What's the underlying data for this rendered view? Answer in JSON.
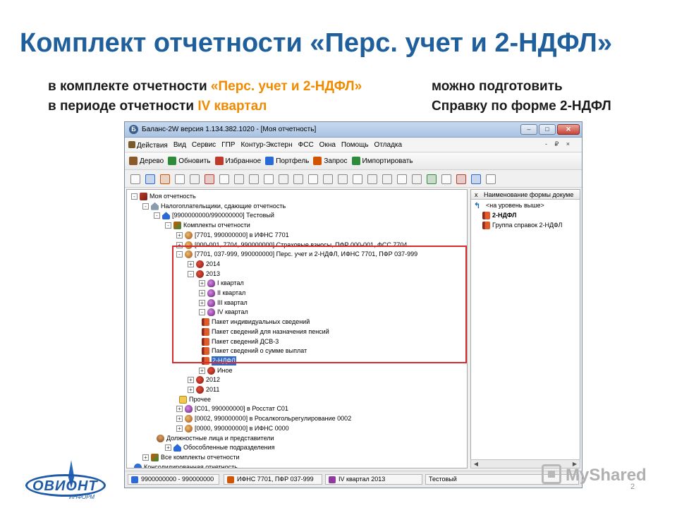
{
  "slide": {
    "title": "Комплект отчетности «Перс. учет и 2-НДФЛ»",
    "lead_l1_a": "в комплекте отчетности ",
    "lead_l1_b": "«Перс. учет и 2-НДФЛ»",
    "lead_l2_a": "в периоде отчетности ",
    "lead_l2_b": "IV квартал",
    "lead_r1": "можно подготовить",
    "lead_r2": "Справку по форме 2-НДФЛ",
    "accent_color": "#f08a00",
    "title_color": "#1f5f9c",
    "page_number": "2"
  },
  "window": {
    "title": "Баланс-2W  версия 1.134.382.1020 - [Моя отчетность]",
    "buttons": {
      "min": "–",
      "max": "□",
      "close": "✕"
    }
  },
  "menu": [
    "Действия",
    "Вид",
    "Сервис",
    "ГПР",
    "Контур-Экстерн",
    "ФСС",
    "Окна",
    "Помощь",
    "Отладка"
  ],
  "mdi_controls": "- ₽ ×",
  "toolbar": [
    "Дерево",
    "Обновить",
    "Избранное",
    "Портфель",
    "Запрос",
    "Импортировать"
  ],
  "tree": [
    {
      "label": "Моя отчетность",
      "icon": "root-icon",
      "level": 0,
      "exp": "-"
    },
    {
      "label": "Налогоплательщики, сдающие отчетность",
      "icon": "home-icon",
      "level": 1,
      "exp": "-"
    },
    {
      "label": "[9900000000/990000000] Тестовый",
      "icon": "house-icon",
      "level": 2,
      "exp": "-"
    },
    {
      "label": "Комплекты отчетности",
      "icon": "set-icon",
      "level": 3,
      "exp": "-"
    },
    {
      "label": "[7701, 990000000] в ИФНС 7701",
      "icon": "kit-icon",
      "level": 4,
      "exp": "+"
    },
    {
      "label": "[000-001, 7704, 990000000] Страховые взносы, ПФР 000-001, ФСС 7704",
      "icon": "kit-icon",
      "level": 4,
      "exp": "+"
    },
    {
      "label": "[7701, 037-999, 990000000] Перс. учет и 2-НДФЛ, ИФНС 7701, ПФР 037-999",
      "icon": "kit-icon",
      "level": 4,
      "exp": "-"
    },
    {
      "label": "2014",
      "icon": "year-icon",
      "level": 5,
      "exp": "+"
    },
    {
      "label": "2013",
      "icon": "year-icon",
      "level": 5,
      "exp": "-"
    },
    {
      "label": "I квартал",
      "icon": "quarter-icon",
      "level": 6,
      "exp": "+"
    },
    {
      "label": "II квартал",
      "icon": "quarter-icon",
      "level": 6,
      "exp": "+"
    },
    {
      "label": "III квартал",
      "icon": "quarter-icon",
      "level": 6,
      "exp": "+"
    },
    {
      "label": "IV квартал",
      "icon": "quarter-icon",
      "level": 6,
      "exp": "-"
    },
    {
      "label": "Пакет индивидуальных сведений",
      "icon": "document-icon",
      "level": 7,
      "exp": ""
    },
    {
      "label": "Пакет сведений для назначения пенсий",
      "icon": "document-icon",
      "level": 7,
      "exp": ""
    },
    {
      "label": "Пакет сведений ДСВ-3",
      "icon": "document-icon",
      "level": 7,
      "exp": ""
    },
    {
      "label": "Пакет сведений о сумме выплат",
      "icon": "document-icon",
      "level": 7,
      "exp": ""
    },
    {
      "label": "2-НДФЛ",
      "icon": "document-icon",
      "level": 7,
      "exp": "",
      "selected": true
    },
    {
      "label": "Иное",
      "icon": "year-icon",
      "level": 6,
      "exp": "+"
    },
    {
      "label": "2012",
      "icon": "year-icon",
      "level": 5,
      "exp": "+"
    },
    {
      "label": "2011",
      "icon": "year-icon",
      "level": 5,
      "exp": "+"
    },
    {
      "label": "Прочее",
      "icon": "folder-icon",
      "level": 5,
      "exp": ""
    },
    {
      "label": "[С01, 990000000] в Росстат С01",
      "icon": "quarter-icon",
      "level": 4,
      "exp": "+"
    },
    {
      "label": "[0002, 990000000] в Росалкогольрегулирование 0002",
      "icon": "kit-icon",
      "level": 4,
      "exp": "+"
    },
    {
      "label": "[0000, 990000000] в ИФНС 0000",
      "icon": "kit-icon",
      "level": 4,
      "exp": "+"
    },
    {
      "label": "Должностные лица и представители",
      "icon": "people-icon",
      "level": 3,
      "exp": ""
    },
    {
      "label": "Обособленные подразделения",
      "icon": "house-icon",
      "level": 3,
      "exp": "+"
    },
    {
      "label": "Все комплекты отчетности",
      "icon": "set-icon",
      "level": 1,
      "exp": "+"
    },
    {
      "label": "Консолидированная отчетность",
      "icon": "consolidated-icon",
      "level": 1,
      "exp": ""
    }
  ],
  "right_pane": {
    "header": "Наименование формы докуме",
    "header_close": "x",
    "up_level": "<на уровень выше>",
    "items": [
      "2-НДФЛ",
      "Группа справок 2-НДФЛ"
    ]
  },
  "statusbar": [
    "9900000000 - 990000000",
    "ИФНС 7701, ПФР 037-999",
    "IV квартал 2013",
    "Тестовый"
  ],
  "logo": {
    "text": "ОВИОНТ",
    "sub": "ИНФОРМ"
  },
  "watermark": "MyShared"
}
